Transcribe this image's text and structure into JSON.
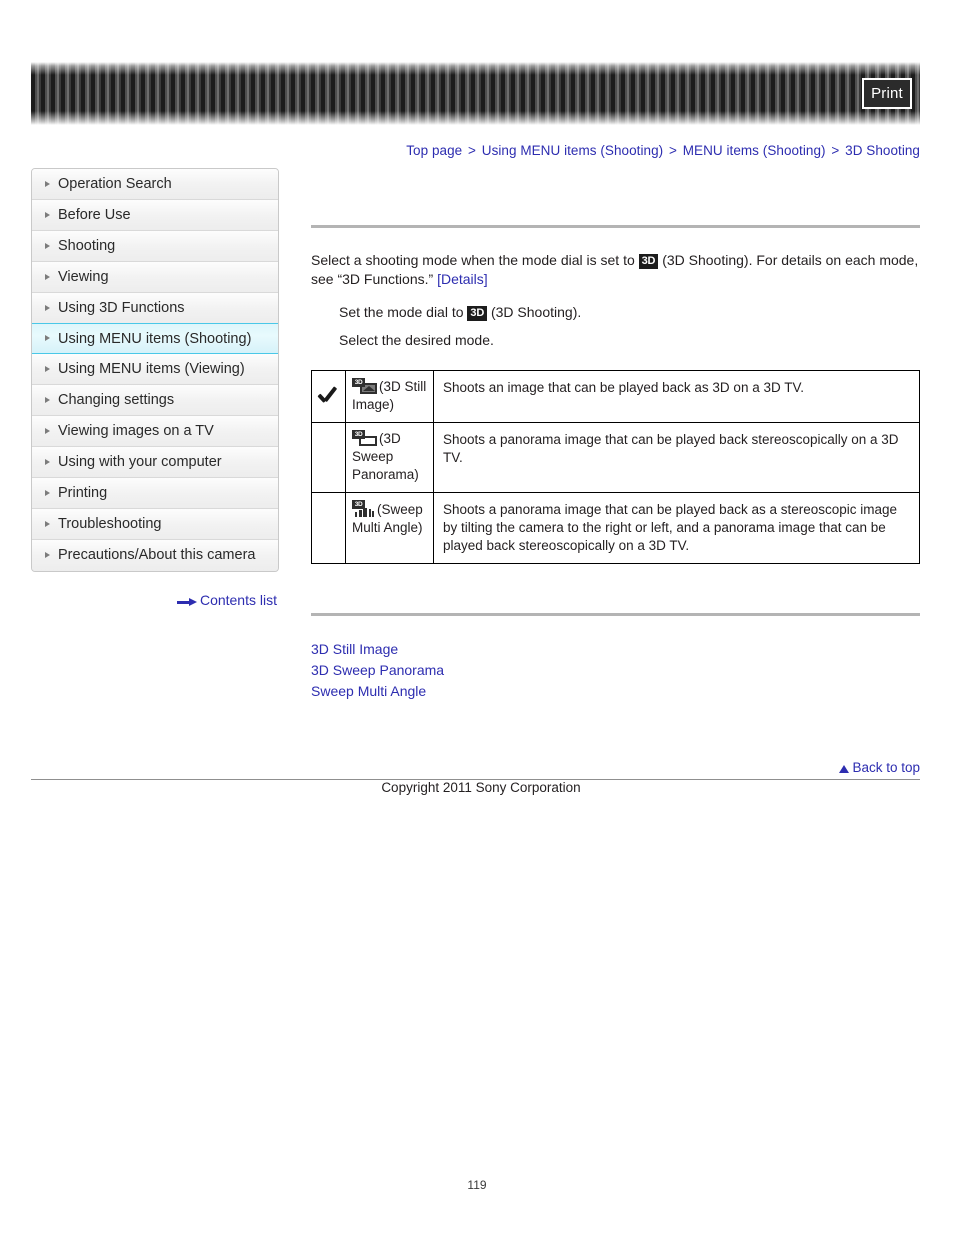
{
  "header": {
    "print_label": "Print"
  },
  "breadcrumb": {
    "separator": ">",
    "items": [
      "Top page",
      "Using MENU items (Shooting)",
      "MENU items (Shooting)",
      "3D Shooting"
    ]
  },
  "sidebar": {
    "items": [
      {
        "label": "Operation Search",
        "active": false
      },
      {
        "label": "Before Use",
        "active": false
      },
      {
        "label": "Shooting",
        "active": false
      },
      {
        "label": "Viewing",
        "active": false
      },
      {
        "label": "Using 3D Functions",
        "active": false
      },
      {
        "label": "Using MENU items (Shooting)",
        "active": true
      },
      {
        "label": "Using MENU items (Viewing)",
        "active": false
      },
      {
        "label": "Changing settings",
        "active": false
      },
      {
        "label": "Viewing images on a TV",
        "active": false
      },
      {
        "label": "Using with your computer",
        "active": false
      },
      {
        "label": "Printing",
        "active": false
      },
      {
        "label": "Troubleshooting",
        "active": false
      },
      {
        "label": "Precautions/About this camera",
        "active": false
      }
    ],
    "contents_list_label": "Contents list"
  },
  "main": {
    "intro_part1": "Select a shooting mode when the mode dial is set to ",
    "badge_3d": "3D",
    "intro_part2": " (3D Shooting). For details on each mode, see “3D Functions.” ",
    "details_link": "[Details]",
    "step1_part1": "Set the mode dial to ",
    "step1_part2": " (3D Shooting).",
    "step2": "Select the desired mode.",
    "table_rows": [
      {
        "checked": true,
        "icon": "3d-still-image-icon",
        "mode": "(3D Still Image)",
        "description": "Shoots an image that can be played back as 3D on a 3D TV."
      },
      {
        "checked": false,
        "icon": "3d-sweep-panorama-icon",
        "mode": "(3D Sweep Panorama)",
        "description": "Shoots a panorama image that can be played back stereoscopically on a 3D TV."
      },
      {
        "checked": false,
        "icon": "sweep-multi-angle-icon",
        "mode": "(Sweep Multi Angle)",
        "description": "Shoots a panorama image that can be played back as a stereoscopic image by tilting the camera to the right or left, and a panorama image that can be played back stereoscopically on a 3D TV."
      }
    ],
    "bottom_links": [
      "3D Still Image",
      "3D Sweep Panorama",
      "Sweep Multi Angle"
    ],
    "back_to_top": "Back to top"
  },
  "footer": {
    "copyright": "Copyright 2011 Sony Corporation",
    "page_number": "119"
  },
  "colors": {
    "link": "#2d2db0",
    "active_sidebar_border": "#49c8e8",
    "badge_bg": "#1c1c1c"
  }
}
